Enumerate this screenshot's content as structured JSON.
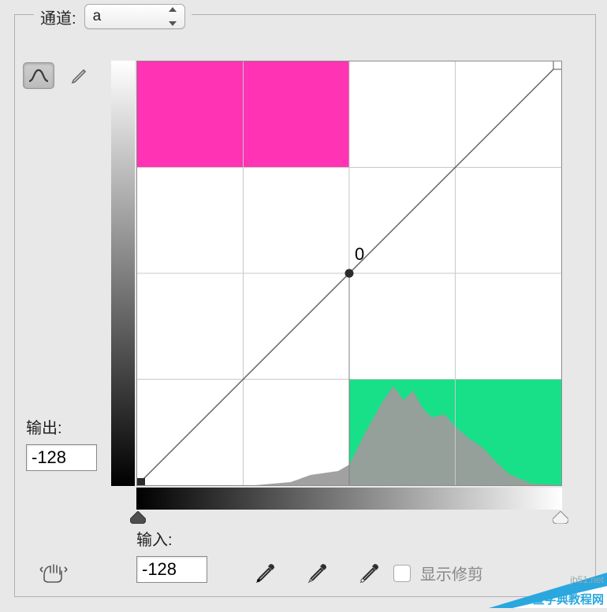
{
  "channel": {
    "label": "通道:",
    "selected_value": "a"
  },
  "tools": {
    "curve_tool_name": "curve-tool",
    "pencil_tool_name": "pencil-tool"
  },
  "curve": {
    "zero_label": "0",
    "points": [
      {
        "in": -128,
        "out": -128
      },
      {
        "in": 128,
        "out": 128
      }
    ],
    "center": {
      "in": 0,
      "out": 0
    }
  },
  "highlights": {
    "magenta": "#ff33b3",
    "green": "#17e088",
    "histogram": "#9c9c9c"
  },
  "output": {
    "label": "输出:",
    "value": "-128"
  },
  "input": {
    "label": "输入:",
    "value": "-128"
  },
  "show_clipping": {
    "label": "显示修剪",
    "checked": false
  },
  "watermark": {
    "text_top": "jb51.net",
    "text_bottom": "查字典教程网"
  },
  "chart_data": {
    "type": "line",
    "title": "",
    "xlabel": "输入",
    "ylabel": "输出",
    "x_range": [
      -128,
      128
    ],
    "y_range": [
      -128,
      128
    ],
    "series": [
      {
        "name": "curve",
        "x": [
          -128,
          0,
          128
        ],
        "y": [
          -128,
          0,
          128
        ]
      }
    ],
    "annotations": [
      {
        "text": "0",
        "x": 0,
        "y": 0
      }
    ],
    "highlight_regions": [
      {
        "color": "#ff33b3",
        "x0": -128,
        "x1": 0,
        "y0": 64,
        "y1": 128
      },
      {
        "color": "#17e088",
        "x0": 0,
        "x1": 128,
        "y0": -128,
        "y1": -64
      }
    ],
    "histogram": {
      "bins_x": [
        -100,
        -80,
        -60,
        -40,
        -20,
        -10,
        0,
        10,
        20,
        30,
        40,
        50,
        55,
        60,
        70,
        80,
        90,
        100,
        110
      ],
      "heights_norm": [
        0.0,
        0.0,
        0.0,
        0.0,
        0.02,
        0.07,
        0.09,
        0.18,
        0.36,
        0.6,
        0.5,
        0.46,
        0.42,
        0.4,
        0.34,
        0.3,
        0.18,
        0.05,
        0.0
      ]
    }
  }
}
